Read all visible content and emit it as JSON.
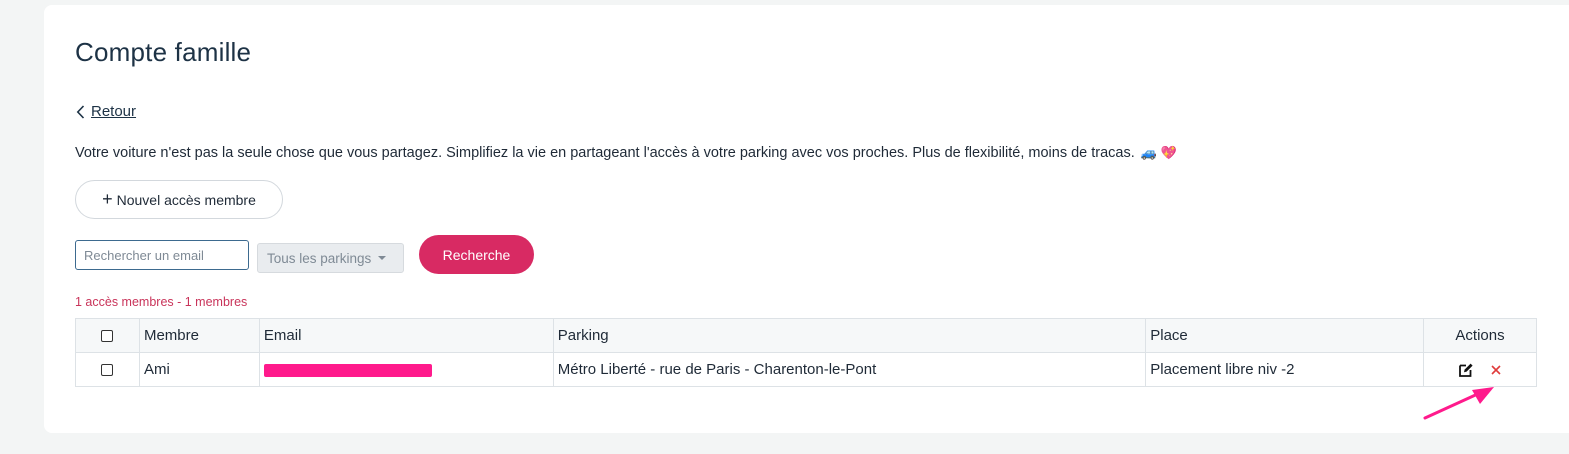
{
  "page": {
    "title": "Compte famille",
    "back_label": "Retour",
    "intro_text": "Votre voiture n'est pas la seule chose que vous partagez. Simplifiez la vie en partageant l'accès à votre parking avec vos proches. Plus de flexibilité, moins de tracas.",
    "intro_emojis": "🚙 💖"
  },
  "toolbar": {
    "new_member_label": "Nouvel accès membre",
    "search_placeholder": "Rechercher un email",
    "parking_filter": "Tous les parkings",
    "search_button": "Recherche"
  },
  "count_text": "1 accès membres - 1 membres",
  "table": {
    "headers": {
      "membre": "Membre",
      "email": "Email",
      "parking": "Parking",
      "place": "Place",
      "actions": "Actions"
    },
    "rows": [
      {
        "membre": "Ami",
        "parking": "Métro Liberté - rue de Paris - Charenton-le-Pont",
        "place": "Placement libre niv -2"
      }
    ]
  },
  "colors": {
    "accent": "#d82a63",
    "count_text": "#c9345a",
    "delete_icon": "#e03b3b",
    "annotation_arrow": "#ff1a8c"
  },
  "icons": {
    "back": "chevron-left-icon",
    "new_member": "plus-icon",
    "edit": "edit-icon",
    "delete": "close-icon"
  }
}
